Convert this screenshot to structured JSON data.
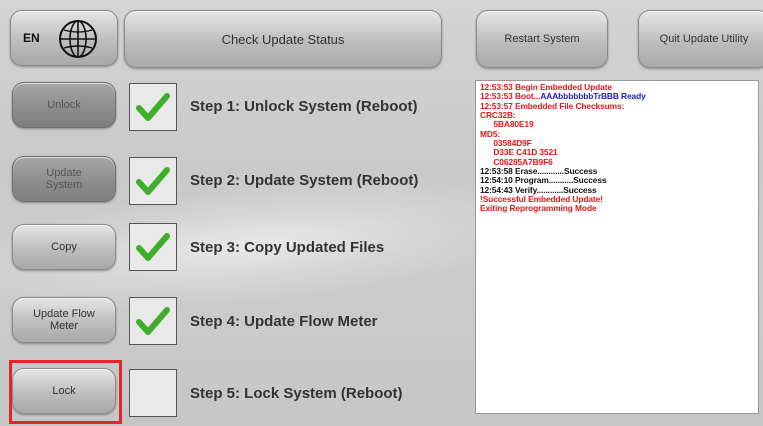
{
  "language": {
    "code": "EN",
    "icon": "globe-icon"
  },
  "top_bar": {
    "check_status_label": "Check Update Status",
    "restart_label": "Restart System",
    "quit_label": "Quit Update Utility"
  },
  "steps": [
    {
      "button_label": "Unlock",
      "label": "Step 1: Unlock System (Reboot)",
      "checked": true
    },
    {
      "button_label": "Update System",
      "label": "Step 2: Update System (Reboot)",
      "checked": true
    },
    {
      "button_label": "Copy",
      "label": "Step 3: Copy Updated Files",
      "checked": true
    },
    {
      "button_label": "Update Flow Meter",
      "label": "Step 4: Update Flow Meter",
      "checked": true
    },
    {
      "button_label": "Lock",
      "label": "Step 5: Lock System (Reboot)",
      "checked": false
    }
  ],
  "log": [
    {
      "text": "12:53:53 Begin Embedded Update",
      "color": "#e8151b"
    },
    {
      "text": "12:53:53 Boot...AAAbbbbbbbTrBBB Ready",
      "color": "#e8151b"
    },
    {
      "text": "12:53:57 Embedded File Checksums:",
      "color": "#e8151b"
    },
    {
      "text": "CRC32B:",
      "color": "#e8151b"
    },
    {
      "text": "      5BA80E19",
      "color": "#e8151b"
    },
    {
      "text": "MD5:",
      "color": "#e8151b"
    },
    {
      "text": "      03584D9F",
      "color": "#e8151b"
    },
    {
      "text": "      D33E C41D 3521",
      "color": "#e8151b"
    },
    {
      "text": "      C06285A7B9F6",
      "color": "#e8151b"
    },
    {
      "text": "12:53:58 Erase............Success",
      "color": "#111111"
    },
    {
      "text": "12:54:10 Program...........Success",
      "color": "#111111"
    },
    {
      "text": "12:54:43 Verify............Success",
      "color": "#111111"
    },
    {
      "text": "!Successful Embedded Update!",
      "color": "#e8151b"
    },
    {
      "text": "Exiting Reprogramming Mode",
      "color": "#e8151b"
    }
  ],
  "colors": {
    "check": "#3fae2a",
    "highlight": "#e4262a",
    "log_red": "#e8151b",
    "log_blue": "#1d1dbf"
  }
}
